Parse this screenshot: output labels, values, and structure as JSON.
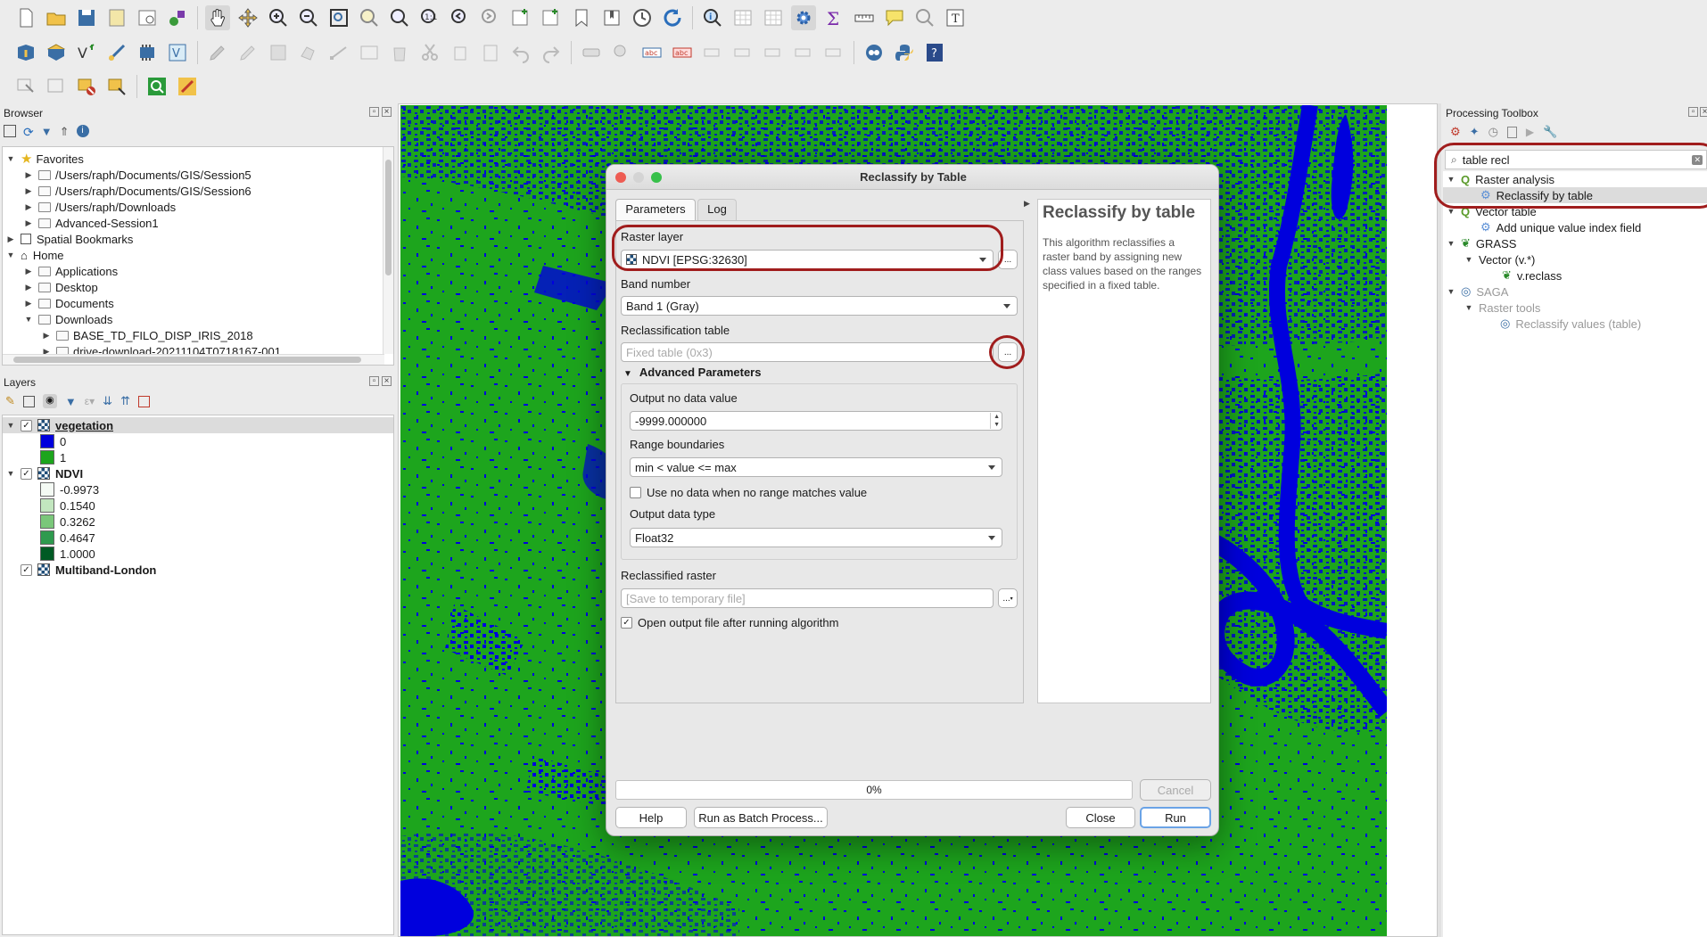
{
  "browser": {
    "title": "Browser",
    "items": [
      {
        "label": "Favorites"
      },
      {
        "label": "/Users/raph/Documents/GIS/Session5"
      },
      {
        "label": "/Users/raph/Documents/GIS/Session6"
      },
      {
        "label": "/Users/raph/Downloads"
      },
      {
        "label": "Advanced-Session1"
      },
      {
        "label": "Spatial Bookmarks"
      },
      {
        "label": "Home"
      },
      {
        "label": "Applications"
      },
      {
        "label": "Desktop"
      },
      {
        "label": "Documents"
      },
      {
        "label": "Downloads"
      },
      {
        "label": "BASE_TD_FILO_DISP_IRIS_2018"
      },
      {
        "label": "drive-download-20211104T0718167-001"
      }
    ]
  },
  "layers": {
    "title": "Layers",
    "items": [
      {
        "label": "vegetation",
        "children": [
          {
            "label": "0",
            "color": "#0000dd"
          },
          {
            "label": "1",
            "color": "#1da51d"
          }
        ]
      },
      {
        "label": "NDVI",
        "children": [
          {
            "label": "-0.9973",
            "color": "#f4faf4"
          },
          {
            "label": "0.1540",
            "color": "#c2e6bf"
          },
          {
            "label": "0.3262",
            "color": "#7ac77a"
          },
          {
            "label": "0.4647",
            "color": "#2e9a4e"
          },
          {
            "label": "1.0000",
            "color": "#005a24"
          }
        ]
      },
      {
        "label": "Multiband-London"
      }
    ]
  },
  "toolbox": {
    "title": "Processing Toolbox",
    "search_value": "table recl",
    "items": [
      {
        "label": "Raster analysis"
      },
      {
        "label": "Reclassify by table"
      },
      {
        "label": "Vector table"
      },
      {
        "label": "Add unique value index field"
      },
      {
        "label": "GRASS"
      },
      {
        "label": "Vector (v.*)"
      },
      {
        "label": "v.reclass"
      },
      {
        "label": "SAGA"
      },
      {
        "label": "Raster tools"
      },
      {
        "label": "Reclassify values (table)"
      }
    ]
  },
  "dialog": {
    "title": "Reclassify by Table",
    "tabs": [
      "Parameters",
      "Log"
    ],
    "raster_layer_label": "Raster layer",
    "raster_layer_value": "NDVI [EPSG:32630]",
    "band_label": "Band number",
    "band_value": "Band 1 (Gray)",
    "reclass_table_label": "Reclassification table",
    "reclass_table_placeholder": "Fixed table (0x3)",
    "advanced_label": "Advanced Parameters",
    "nodata_label": "Output no data value",
    "nodata_value": "-9999.000000",
    "range_label": "Range boundaries",
    "range_value": "min < value <= max",
    "use_nodata_label": "Use no data when no range matches value",
    "dtype_label": "Output data type",
    "dtype_value": "Float32",
    "reclassified_label": "Reclassified raster",
    "reclassified_placeholder": "[Save to temporary file]",
    "open_output_label": "Open output file after running algorithm",
    "ellipsis": "...",
    "help_title": "Reclassify by table",
    "help_text": "This algorithm reclassifies a raster band by assigning new class values based on the ranges specified in a fixed table.",
    "progress": "0%",
    "progress_fraction": 0,
    "buttons": {
      "cancel": "Cancel",
      "help": "Help",
      "batch": "Run as Batch Process...",
      "close": "Close",
      "run": "Run"
    }
  },
  "colors": {
    "map_green": "#1da51d",
    "map_blue": "#0000dd",
    "annotation_red": "#a01d1d",
    "selection": "#dcdcdc"
  }
}
